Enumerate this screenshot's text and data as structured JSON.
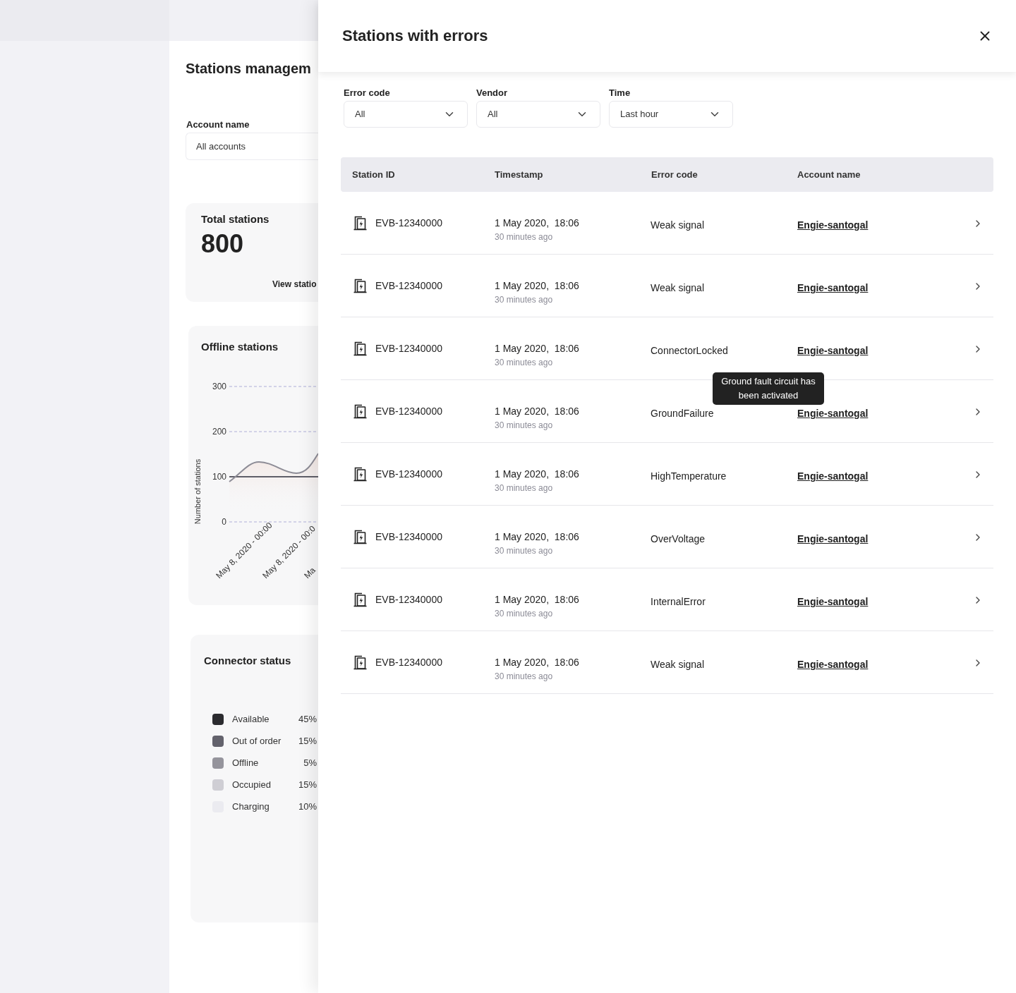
{
  "page": {
    "title": "Stations managem",
    "account_filter": {
      "label": "Account name",
      "value": "All accounts"
    },
    "total_stations": {
      "title": "Total stations",
      "value": "800",
      "link": "View statio"
    },
    "offline_stations": {
      "title": "Offline stations",
      "ylabel": "Number of stations",
      "yticks": [
        "300",
        "200",
        "100",
        "0"
      ],
      "xlabels": [
        "May 8, 2020 - 00:00",
        "May 8, 2020 - 00:0",
        "Ma"
      ]
    },
    "connector_status": {
      "title": "Connector status",
      "legend": [
        {
          "label": "Available",
          "value": "45%",
          "color": "#2b2b2f"
        },
        {
          "label": "Out of order",
          "value": "15%",
          "color": "#63626c"
        },
        {
          "label": "Offline",
          "value": "5%",
          "color": "#95949c"
        },
        {
          "label": "Occupied",
          "value": "15%",
          "color": "#cfced4"
        },
        {
          "label": "Charging",
          "value": "10%",
          "color": "#ebebf0"
        }
      ]
    }
  },
  "drawer": {
    "title": "Stations with errors",
    "filters": [
      {
        "label": "Error code",
        "value": "All"
      },
      {
        "label": "Vendor",
        "value": "All"
      },
      {
        "label": "Time",
        "value": "Last hour"
      }
    ],
    "table": {
      "columns": [
        "Station ID",
        "Timestamp",
        "Error code",
        "Account name"
      ],
      "rows": [
        {
          "station_id": "EVB-12340000",
          "timestamp": "1 May 2020,  18:06",
          "relative_time": "30 minutes ago",
          "error_code": "Weak signal",
          "account": "Engie-santogal"
        },
        {
          "station_id": "EVB-12340000",
          "timestamp": "1 May 2020,  18:06",
          "relative_time": "30 minutes ago",
          "error_code": "Weak signal",
          "account": "Engie-santogal"
        },
        {
          "station_id": "EVB-12340000",
          "timestamp": "1 May 2020,  18:06",
          "relative_time": "30 minutes ago",
          "error_code": "ConnectorLocked",
          "account": "Engie-santogal"
        },
        {
          "station_id": "EVB-12340000",
          "timestamp": "1 May 2020,  18:06",
          "relative_time": "30 minutes ago",
          "error_code": "GroundFailure",
          "account": "Engie-santogal",
          "tooltip": "Ground fault circuit has been activated"
        },
        {
          "station_id": "EVB-12340000",
          "timestamp": "1 May 2020,  18:06",
          "relative_time": "30 minutes ago",
          "error_code": "HighTemperature",
          "account": "Engie-santogal"
        },
        {
          "station_id": "EVB-12340000",
          "timestamp": "1 May 2020,  18:06",
          "relative_time": "30 minutes ago",
          "error_code": "OverVoltage",
          "account": "Engie-santogal"
        },
        {
          "station_id": "EVB-12340000",
          "timestamp": "1 May 2020,  18:06",
          "relative_time": "30 minutes ago",
          "error_code": "InternalError",
          "account": "Engie-santogal"
        },
        {
          "station_id": "EVB-12340000",
          "timestamp": "1 May 2020,  18:06",
          "relative_time": "30 minutes ago",
          "error_code": "Weak signal",
          "account": "Engie-santogal"
        }
      ]
    }
  }
}
